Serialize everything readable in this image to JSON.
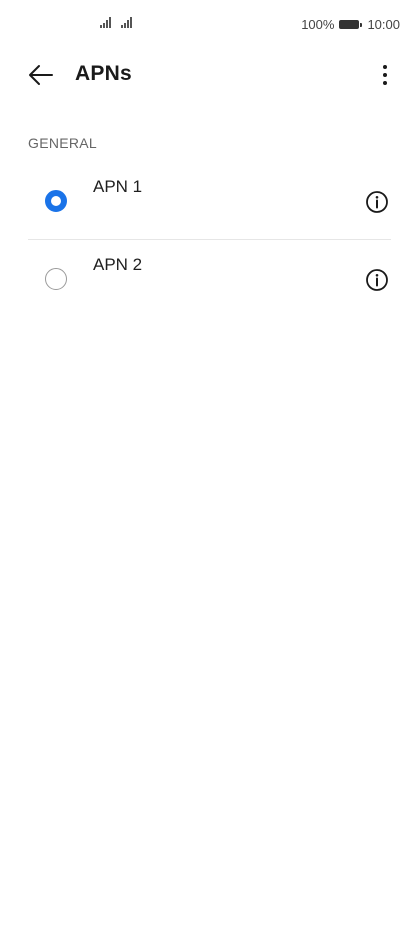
{
  "status_bar": {
    "battery_percent": "100%",
    "time": "10:00",
    "icons": [
      "signal-icon",
      "signal-icon",
      "battery-icon"
    ]
  },
  "app_bar": {
    "title": "APNs",
    "back_icon": "arrow-left-icon",
    "more_icon": "more-vertical-icon"
  },
  "section": {
    "header": "GENERAL"
  },
  "apns": [
    {
      "name": "APN 1",
      "selected": true
    },
    {
      "name": "APN 2",
      "selected": false
    }
  ],
  "colors": {
    "accent": "#1a73e8",
    "text": "#1f1f1f",
    "secondary_text": "#666666",
    "divider": "#e6e6e6"
  }
}
